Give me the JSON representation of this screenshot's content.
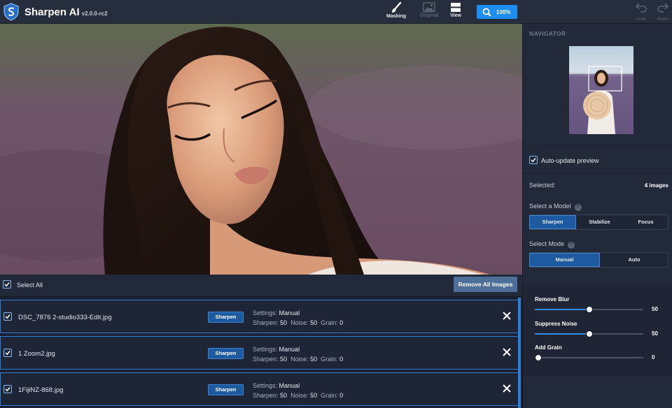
{
  "app": {
    "title": "Sharpen AI",
    "version": "v2.0.0-rc2"
  },
  "toolbar": {
    "masking_label": "Masking",
    "original_label": "Original",
    "view_label": "View",
    "zoom_label": "100%",
    "undo_label": "Undo",
    "redo_label": "Redo"
  },
  "selection_bar": {
    "select_all_label": "Select All",
    "remove_all_label": "Remove All Images"
  },
  "images": [
    {
      "filename": "DSC_7876 2-studio333-Edit.jpg",
      "model": "Sharpen",
      "settings_label": "Settings:",
      "settings_value": "Manual",
      "sharpen_label": "Sharpen:",
      "sharpen": "50",
      "noise_label": "Noise:",
      "noise": "50",
      "grain_label": "Grain:",
      "grain": "0"
    },
    {
      "filename": "1 Zoom2.jpg",
      "model": "Sharpen",
      "settings_label": "Settings:",
      "settings_value": "Manual",
      "sharpen_label": "Sharpen:",
      "sharpen": "50",
      "noise_label": "Noise:",
      "noise": "50",
      "grain_label": "Grain:",
      "grain": "0"
    },
    {
      "filename": "1FijiNZ-868.jpg",
      "model": "Sharpen",
      "settings_label": "Settings:",
      "settings_value": "Manual",
      "sharpen_label": "Sharpen:",
      "sharpen": "50",
      "noise_label": "Noise:",
      "noise": "50",
      "grain_label": "Grain:",
      "grain": "0"
    }
  ],
  "panel": {
    "navigator_title": "NAVIGATOR",
    "auto_update_label": "Auto-update preview",
    "selected_label": "Selected:",
    "selected_count": "4 images",
    "model_label": "Select a Model",
    "models": [
      "Sharpen",
      "Stabilize",
      "Focus"
    ],
    "active_model": "Sharpen",
    "mode_label": "Select Mode",
    "modes": [
      "Manual",
      "Auto"
    ],
    "active_mode": "Manual",
    "help_glyph": "?",
    "sliders": [
      {
        "label": "Remove Blur",
        "value": "50",
        "fraction": 0.5
      },
      {
        "label": "Suppress Noise",
        "value": "50",
        "fraction": 0.5
      },
      {
        "label": "Add Grain",
        "value": "0",
        "fraction": 0.0
      }
    ]
  },
  "colors": {
    "accent": "#1d8ef0",
    "selected_button": "#1d5aa0",
    "row_border": "#2f7fd6",
    "background": "#1e2433"
  }
}
